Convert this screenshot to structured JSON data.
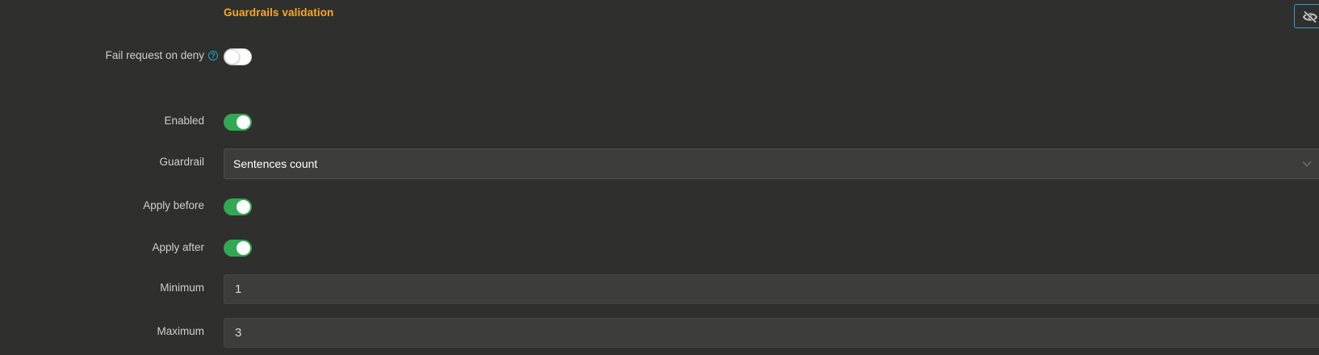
{
  "section": {
    "title": "Guardrails validation",
    "visibility_toggle_icon": "eye-slash-icon"
  },
  "fail_request_on_deny": {
    "label": "Fail request on deny",
    "help_icon": "question-circle-icon",
    "help_glyph": "?",
    "enabled": false
  },
  "enabled": {
    "label": "Enabled",
    "enabled": true
  },
  "guardrail": {
    "label": "Guardrail",
    "selected_value": "Sentences count",
    "dropdown_icon": "chevron-down-icon"
  },
  "apply_before": {
    "label": "Apply before",
    "enabled": true
  },
  "apply_after": {
    "label": "Apply after",
    "enabled": true
  },
  "minimum": {
    "label": "Minimum",
    "value": "1"
  },
  "maximum": {
    "label": "Maximum",
    "value": "3"
  },
  "colors": {
    "background": "#2f2f2d",
    "accent_title": "#f9a825",
    "toggle_on": "#33a852",
    "help_icon": "#1fa3c9",
    "focus_border": "#3a99c9"
  }
}
